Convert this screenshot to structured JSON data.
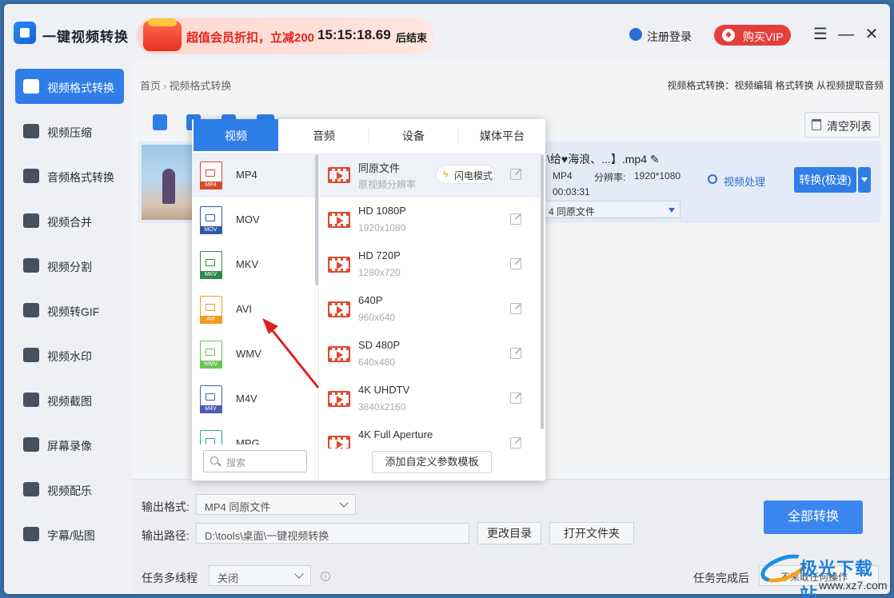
{
  "app": {
    "title": "一键视频转换"
  },
  "promo": {
    "text": "超值会员折扣，立减200",
    "countdown": "15:15:18.69",
    "suffix": "后结束"
  },
  "header": {
    "login": "注册登录",
    "vip": "购买VIP",
    "vip_icon": "diamond-icon"
  },
  "sidebar": {
    "items": [
      {
        "label": "视频格式转换",
        "active": true
      },
      {
        "label": "视频压缩"
      },
      {
        "label": "音频格式转换"
      },
      {
        "label": "视频合并"
      },
      {
        "label": "视频分割"
      },
      {
        "label": "视频转GIF"
      },
      {
        "label": "视频水印"
      },
      {
        "label": "视频截图"
      },
      {
        "label": "屏幕录像"
      },
      {
        "label": "视频配乐"
      },
      {
        "label": "字幕/贴图"
      }
    ]
  },
  "breadcrumb": {
    "home": "首页",
    "current": "视频格式转换"
  },
  "breadcrumb_right": "视频格式转换：视频编辑 格式转换 从视频提取音频",
  "toolbar": {
    "clear": "清空列表"
  },
  "file": {
    "name": "\\给♥海浪、...】.mp4",
    "format": "MP4",
    "resolution_label": "分辨率:",
    "resolution": "1920*1080",
    "duration": "00:03:31",
    "preset": "4 同原文件",
    "process": "视频处理",
    "convert": "转换(极速)"
  },
  "bottom": {
    "output_format_label": "输出格式:",
    "output_format": "MP4  同原文件",
    "output_path_label": "输出路径:",
    "output_path": "D:\\tools\\桌面\\一键视频转换",
    "change_dir": "更改目录",
    "open_folder": "打开文件夹",
    "multithread_label": "任务多线程",
    "multithread": "关闭",
    "after_task_label": "任务完成后",
    "after_task": "不采取任何操作",
    "convert_all": "全部转换"
  },
  "panel": {
    "tabs": [
      "视频",
      "音频",
      "设备",
      "媒体平台"
    ],
    "formats": [
      {
        "label": "MP4",
        "color": "#d94a2b"
      },
      {
        "label": "MOV",
        "color": "#2f5aa8"
      },
      {
        "label": "MKV",
        "color": "#2e8a4a"
      },
      {
        "label": "AVI",
        "color": "#f29a1f"
      },
      {
        "label": "WMV",
        "color": "#6cc25a"
      },
      {
        "label": "M4V",
        "color": "#4a5cb8"
      },
      {
        "label": "MPG",
        "color": "#2aa89a"
      }
    ],
    "search_placeholder": "搜索",
    "presets": [
      {
        "name": "同原文件",
        "res": "原视频分辨率",
        "flash": "闪电模式"
      },
      {
        "name": "HD 1080P",
        "res": "1920x1080"
      },
      {
        "name": "HD 720P",
        "res": "1280x720"
      },
      {
        "name": "640P",
        "res": "960x640"
      },
      {
        "name": "SD 480P",
        "res": "640x480"
      },
      {
        "name": "4K UHDTV",
        "res": "3840x2160"
      },
      {
        "name": "4K Full Aperture",
        "res": ""
      }
    ],
    "add_template": "添加自定义参数模板"
  },
  "watermark": {
    "text": "极光下载站",
    "url": "www.xz7.com"
  },
  "colors": {
    "accent": "#2f7ee8",
    "annotation": "#e02020"
  }
}
